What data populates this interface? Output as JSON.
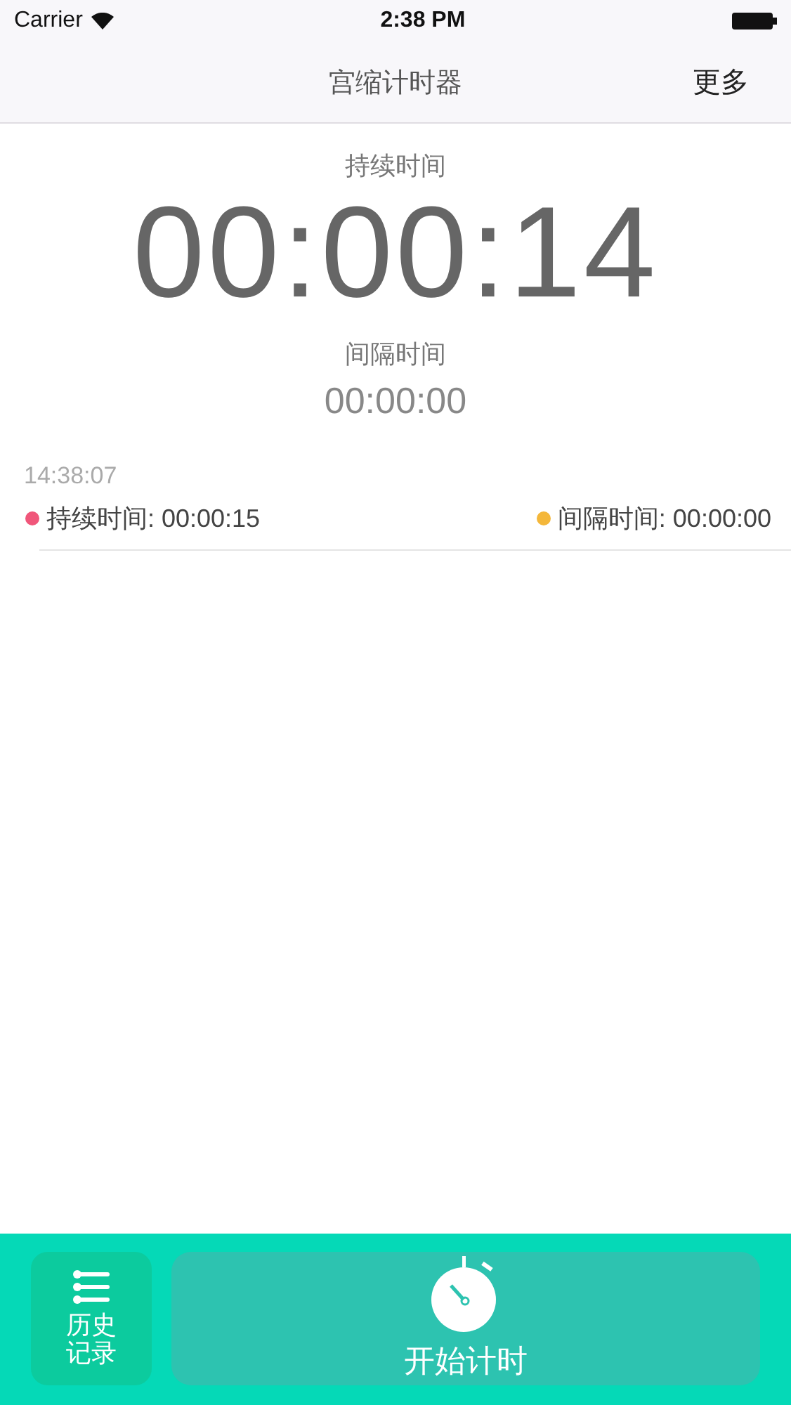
{
  "status_bar": {
    "carrier": "Carrier",
    "time": "2:38 PM"
  },
  "nav": {
    "title": "宫缩计时器",
    "more": "更多"
  },
  "timer": {
    "duration_label": "持续时间",
    "duration": "00:00:14",
    "interval_label": "间隔时间",
    "interval": "00:00:00"
  },
  "records": [
    {
      "time": "14:38:07",
      "entries": [
        {
          "text": "持续时间: 00:00:15",
          "color": "#f0567a"
        },
        {
          "text": "间隔时间: 00:00:00",
          "color": "#f4b73a"
        }
      ]
    }
  ],
  "bottom": {
    "history": "历史记录",
    "start": "开始计时"
  }
}
